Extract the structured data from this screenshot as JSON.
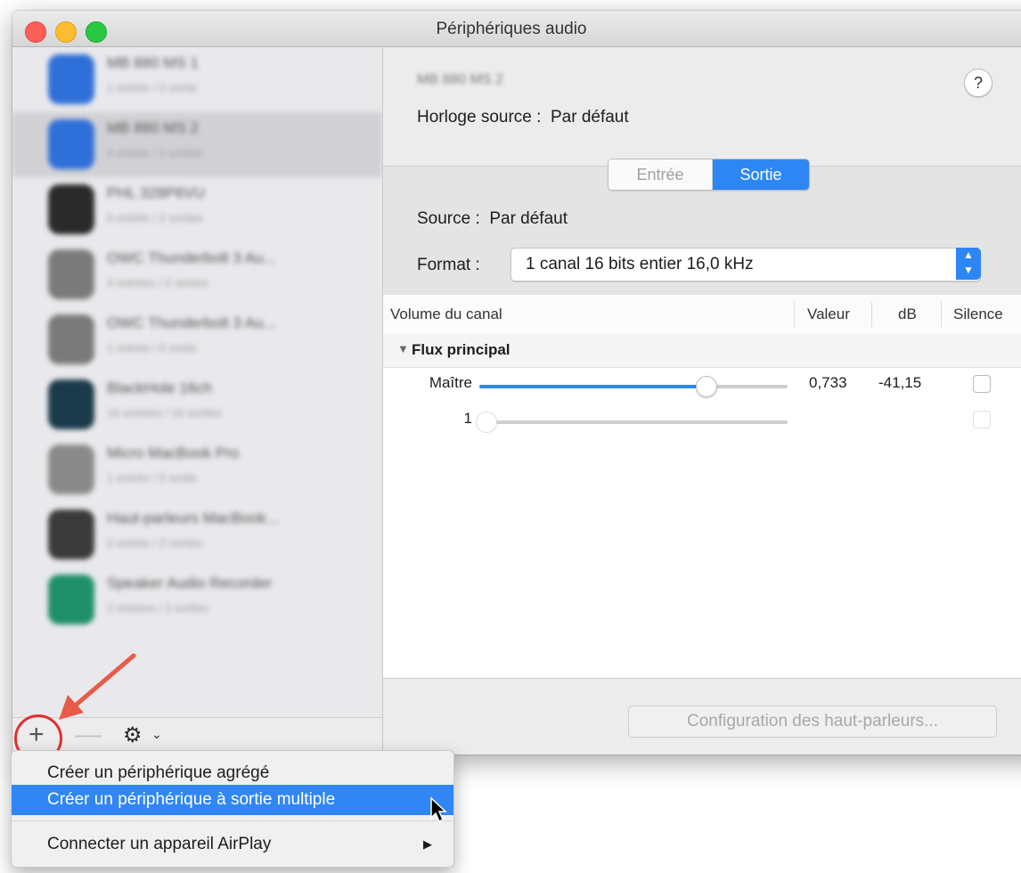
{
  "window": {
    "title": "Périphériques audio"
  },
  "sidebar": {
    "devices": [
      {
        "name": "MB 880 MS 1",
        "subtitle": "1 entrée / 0 sortie",
        "icon": "bluetooth-icon",
        "color": "#2f6fd8"
      },
      {
        "name": "MB 880 MS 2",
        "subtitle": "0 entrée / 2 sorties",
        "icon": "bluetooth-icon",
        "color": "#2f6fd8",
        "selected": true
      },
      {
        "name": "PHL 328P6VU",
        "subtitle": "0 entrée / 2 sorties",
        "icon": "displayport-icon",
        "color": "#2a2a2a"
      },
      {
        "name": "OWC Thunderbolt 3 Au...",
        "subtitle": "4 entrées / 2 sorties",
        "icon": "usb-icon",
        "color": "#7a7a7a"
      },
      {
        "name": "OWC Thunderbolt 3 Au...",
        "subtitle": "1 entrée / 0 sortie",
        "icon": "usb-icon",
        "color": "#7a7a7a"
      },
      {
        "name": "BlackHole 16ch",
        "subtitle": "16 entrées / 16 sorties",
        "icon": "blackhole-icon",
        "color": "#1b3a4a"
      },
      {
        "name": "Micro MacBook Pro",
        "subtitle": "1 entrée / 0 sortie",
        "icon": "microphone-icon",
        "color": "#8a8a8a"
      },
      {
        "name": "Haut-parleurs MacBook...",
        "subtitle": "0 entrée / 2 sorties",
        "icon": "speaker-icon",
        "color": "#3a3a3a"
      },
      {
        "name": "Speaker Audio Recorder",
        "subtitle": "2 entrées / 2 sorties",
        "icon": "recorder-icon",
        "color": "#1f8f6a"
      }
    ],
    "add_button": "+",
    "remove_button": "—",
    "gear": "⚙",
    "gear_caret": "⌄"
  },
  "detail": {
    "device_name": "MB 880 MS 2",
    "help": "?",
    "clock_label": "Horloge source :",
    "clock_value": "Par défaut",
    "tabs": {
      "input": "Entrée",
      "output": "Sortie"
    },
    "source_label": "Source :",
    "source_value": "Par défaut",
    "format_label": "Format :",
    "format_value": "1 canal 16 bits entier 16,0 kHz",
    "stepper": "⌃⌄",
    "table": {
      "columns": [
        "Volume du canal",
        "Valeur",
        "dB",
        "Silence"
      ],
      "group": "Flux principal",
      "group_triangle": "▼",
      "rows": [
        {
          "label": "Maître",
          "valeur": "0,733",
          "db": "-41,15",
          "volume": 0.733,
          "enabled": true
        },
        {
          "label": "1",
          "valeur": "",
          "db": "",
          "volume": 0.0,
          "enabled": false
        }
      ]
    },
    "speaker_config_button": "Configuration des haut-parleurs..."
  },
  "menu": {
    "items": [
      {
        "label": "Créer un périphérique agrégé"
      },
      {
        "label": "Créer un périphérique à sortie multiple",
        "highlighted": true
      },
      {
        "label": "Connecter un appareil AirPlay",
        "submenu": "▶"
      }
    ]
  },
  "colors": {
    "accent": "#2e86f5",
    "annotation": "#e03030"
  }
}
